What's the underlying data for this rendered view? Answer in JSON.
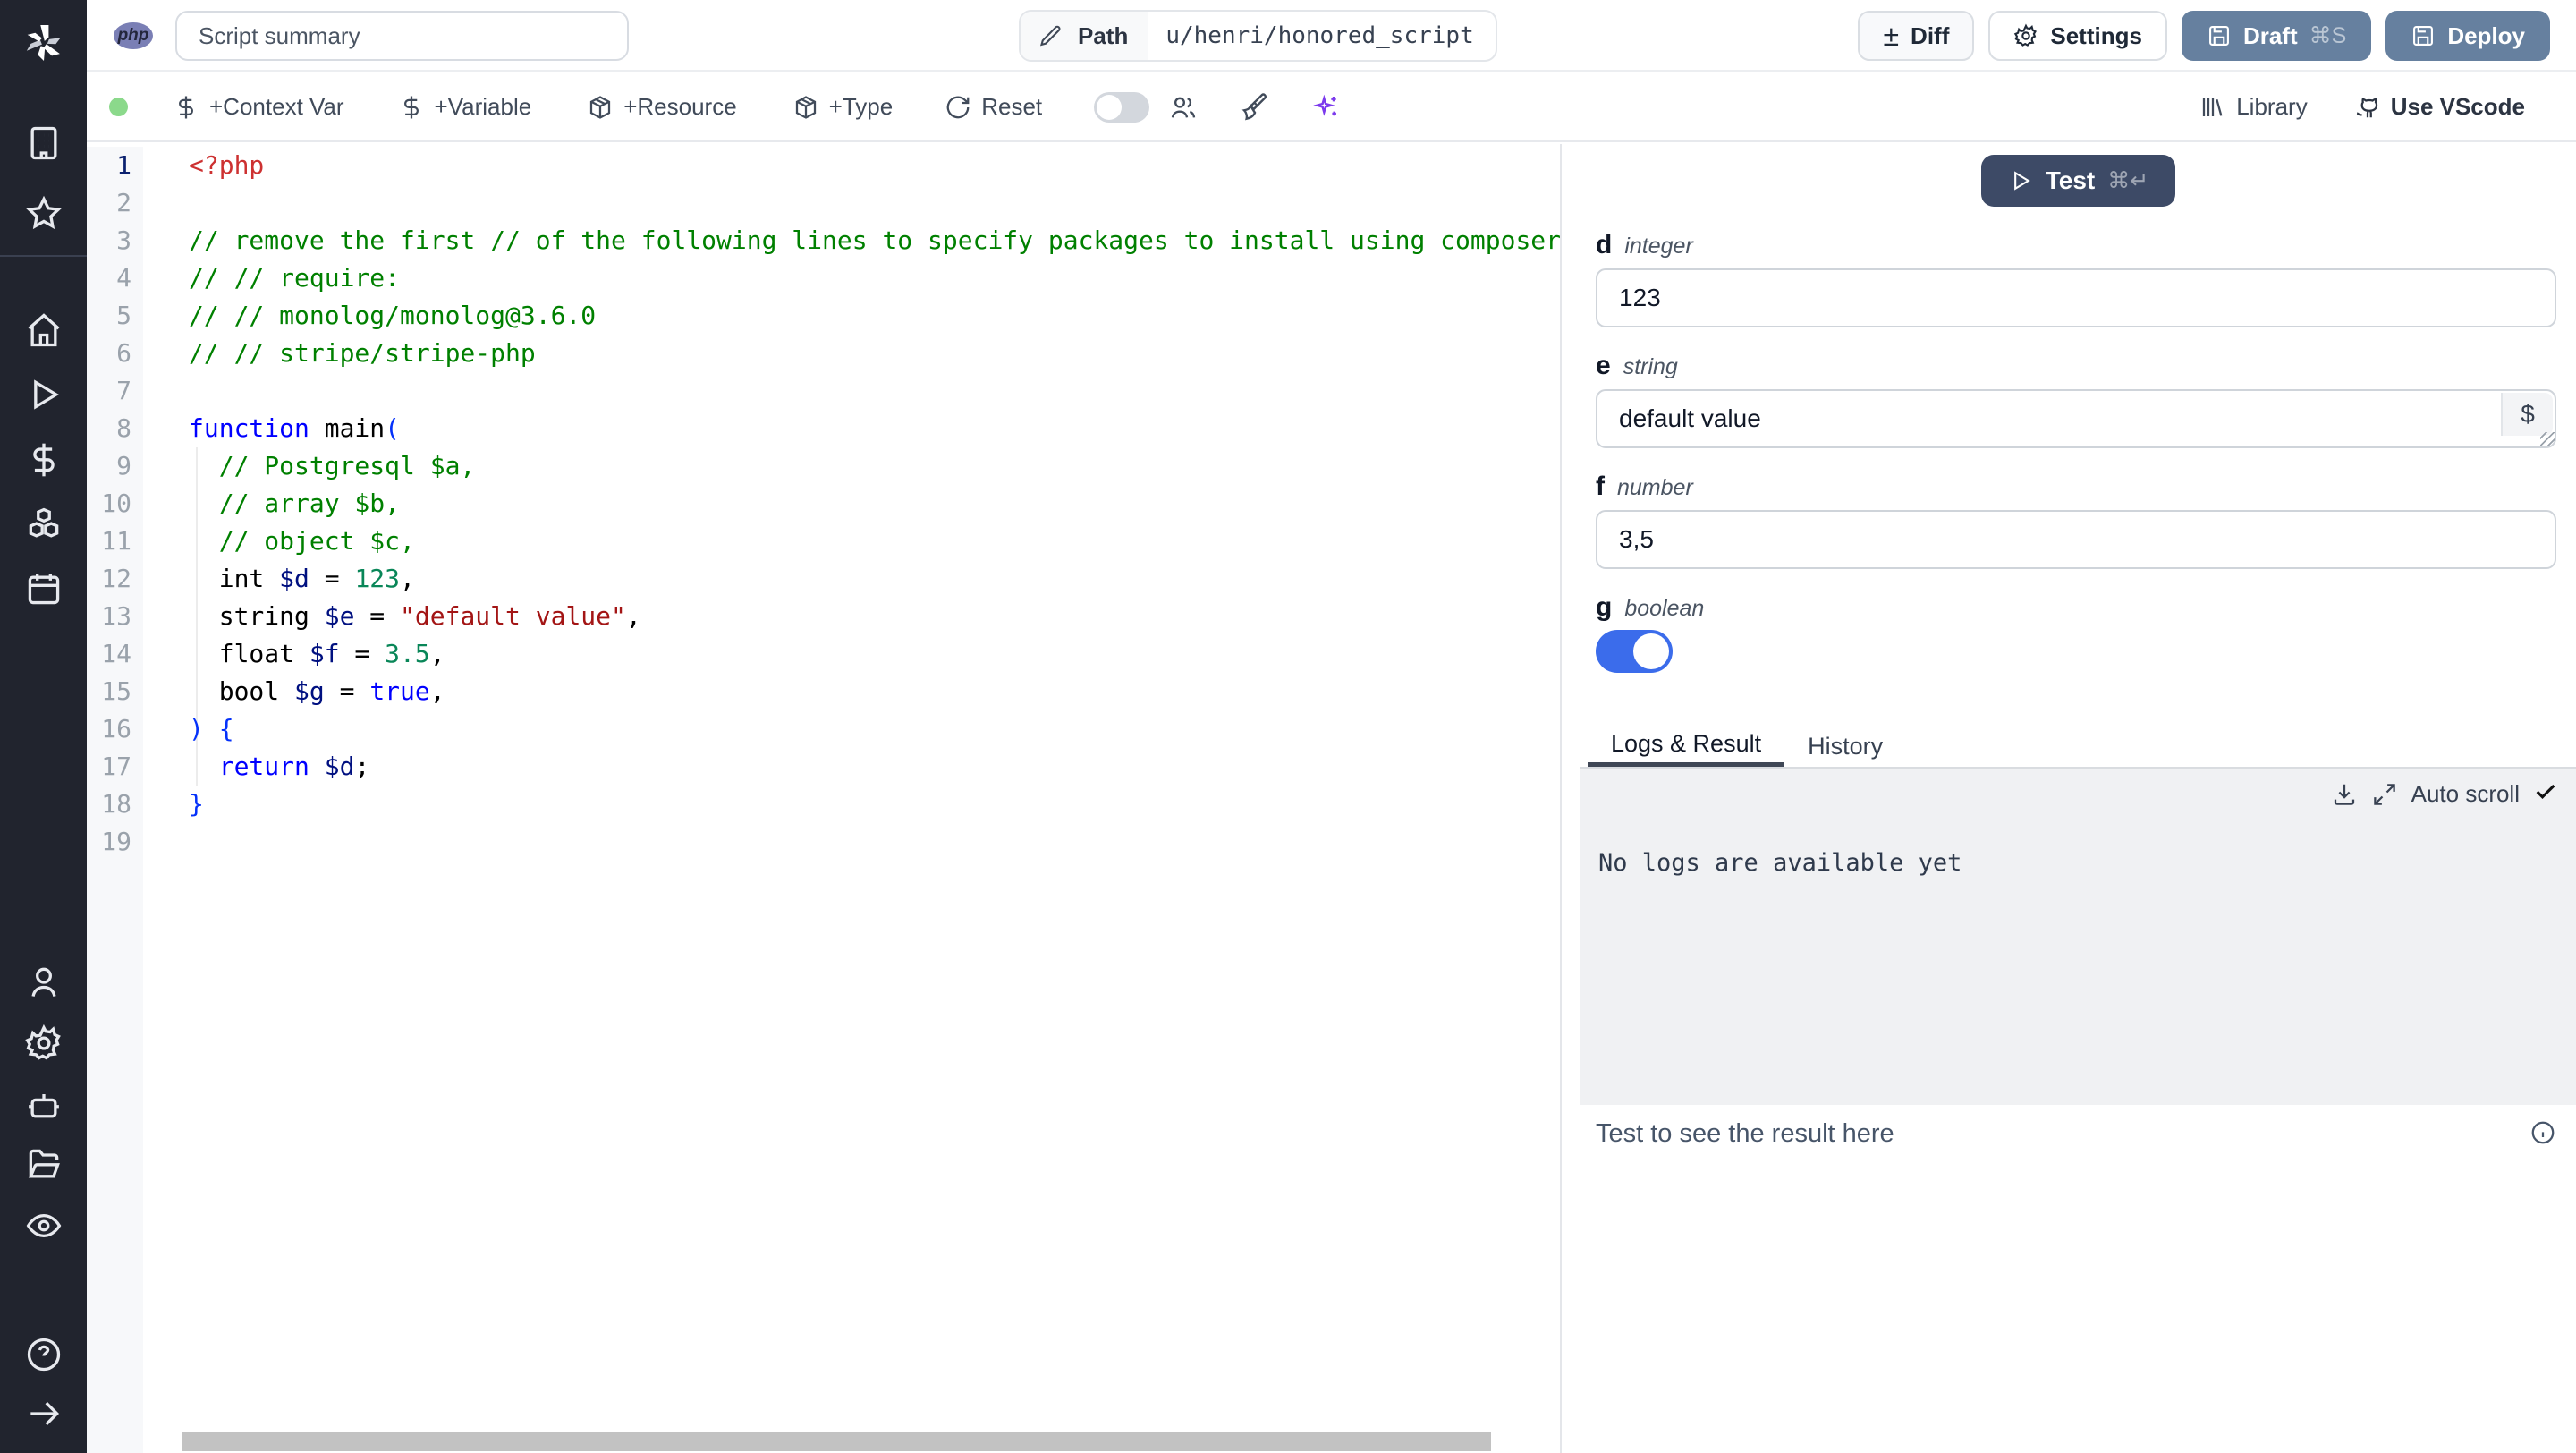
{
  "topbar": {
    "language_badge": "php",
    "summary_placeholder": "Script summary",
    "path_label": "Path",
    "path_value": "u/henri/honored_script",
    "diff_label": "Diff",
    "diff_symbol": "±",
    "settings_label": "Settings",
    "draft_label": "Draft",
    "draft_shortcut": "⌘S",
    "deploy_label": "Deploy"
  },
  "toolbar": {
    "status_dot_color": "#8bd98b",
    "context_var_label": "+Context Var",
    "variable_label": "+Variable",
    "resource_label": "+Resource",
    "type_label": "+Type",
    "reset_label": "Reset",
    "assistant_toggle_state": "off",
    "library_label": "Library",
    "vscode_label": "Use VScode"
  },
  "sidebar": {
    "icons": [
      "windmill-logo",
      "building",
      "star",
      "home",
      "play",
      "dollar",
      "boxes",
      "calendar",
      "user",
      "settings",
      "bot",
      "folder-open",
      "eye",
      "help-circle",
      "arrow-right"
    ]
  },
  "editor": {
    "token_colors": {
      "tag": "#cd3131",
      "comment": "#008000",
      "kw": "#0000ff",
      "var": "#001080",
      "num": "#098658",
      "str": "#a31515",
      "plain": "#000000",
      "bracket": "#0431fa"
    },
    "lines": [
      {
        "num": 1,
        "active": true,
        "tokens": [
          {
            "t": "<?php",
            "c": "tag"
          }
        ]
      },
      {
        "num": 2,
        "tokens": []
      },
      {
        "num": 3,
        "tokens": [
          {
            "t": "// remove the first // of the following lines to specify packages to install using composer:",
            "c": "comment"
          }
        ]
      },
      {
        "num": 4,
        "tokens": [
          {
            "t": "// // require:",
            "c": "comment"
          }
        ]
      },
      {
        "num": 5,
        "tokens": [
          {
            "t": "// // monolog/monolog@3.6.0",
            "c": "comment"
          }
        ]
      },
      {
        "num": 6,
        "tokens": [
          {
            "t": "// // stripe/stripe-php",
            "c": "comment"
          }
        ]
      },
      {
        "num": 7,
        "tokens": []
      },
      {
        "num": 8,
        "tokens": [
          {
            "t": "function",
            "c": "kw"
          },
          {
            "t": " main",
            "c": "plain"
          },
          {
            "t": "(",
            "c": "bracket"
          }
        ]
      },
      {
        "num": 9,
        "tokens": [
          {
            "t": "  // Postgresql $a,",
            "c": "comment"
          }
        ]
      },
      {
        "num": 10,
        "tokens": [
          {
            "t": "  // array $b,",
            "c": "comment"
          }
        ]
      },
      {
        "num": 11,
        "tokens": [
          {
            "t": "  // object $c,",
            "c": "comment"
          }
        ]
      },
      {
        "num": 12,
        "tokens": [
          {
            "t": "  int ",
            "c": "plain"
          },
          {
            "t": "$d",
            "c": "var"
          },
          {
            "t": " = ",
            "c": "plain"
          },
          {
            "t": "123",
            "c": "num"
          },
          {
            "t": ",",
            "c": "plain"
          }
        ]
      },
      {
        "num": 13,
        "tokens": [
          {
            "t": "  string ",
            "c": "plain"
          },
          {
            "t": "$e",
            "c": "var"
          },
          {
            "t": " = ",
            "c": "plain"
          },
          {
            "t": "\"default value\"",
            "c": "str"
          },
          {
            "t": ",",
            "c": "plain"
          }
        ]
      },
      {
        "num": 14,
        "tokens": [
          {
            "t": "  float ",
            "c": "plain"
          },
          {
            "t": "$f",
            "c": "var"
          },
          {
            "t": " = ",
            "c": "plain"
          },
          {
            "t": "3.5",
            "c": "num"
          },
          {
            "t": ",",
            "c": "plain"
          }
        ]
      },
      {
        "num": 15,
        "tokens": [
          {
            "t": "  bool ",
            "c": "plain"
          },
          {
            "t": "$g",
            "c": "var"
          },
          {
            "t": " = ",
            "c": "plain"
          },
          {
            "t": "true",
            "c": "kw"
          },
          {
            "t": ",",
            "c": "plain"
          }
        ]
      },
      {
        "num": 16,
        "tokens": [
          {
            "t": ") {",
            "c": "bracket"
          }
        ]
      },
      {
        "num": 17,
        "tokens": [
          {
            "t": "  ",
            "c": "plain"
          },
          {
            "t": "return",
            "c": "kw"
          },
          {
            "t": " ",
            "c": "plain"
          },
          {
            "t": "$d",
            "c": "var"
          },
          {
            "t": ";",
            "c": "plain"
          }
        ]
      },
      {
        "num": 18,
        "tokens": [
          {
            "t": "}",
            "c": "bracket"
          }
        ]
      },
      {
        "num": 19,
        "tokens": []
      }
    ]
  },
  "panel": {
    "test_label": "Test",
    "test_shortcut": "⌘↵",
    "test_button_color": "#3d4a66",
    "args": [
      {
        "name": "d",
        "type": "integer",
        "value": "123"
      },
      {
        "name": "e",
        "type": "string",
        "value": "default value",
        "dollar_button": "$"
      },
      {
        "name": "f",
        "type": "number",
        "value": "3,5"
      },
      {
        "name": "g",
        "type": "boolean",
        "value": true,
        "toggle_color": "#3b6ceb"
      }
    ],
    "tabs": {
      "logs_result": "Logs & Result",
      "history": "History",
      "active": "Logs & Result"
    },
    "logs": {
      "auto_scroll_label": "Auto scroll",
      "empty_message": "No logs are available yet"
    },
    "result": {
      "placeholder": "Test to see the result here"
    }
  }
}
